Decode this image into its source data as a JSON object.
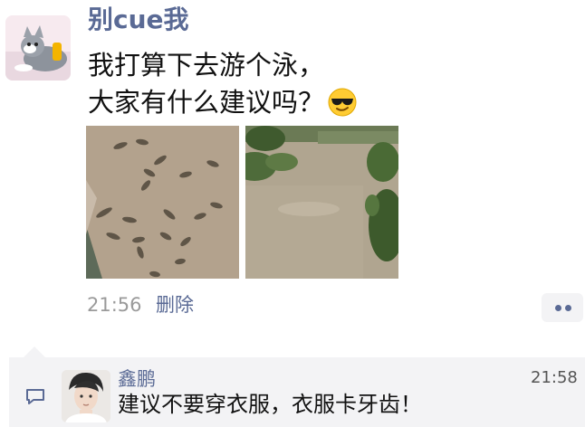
{
  "post": {
    "username": "别cue我",
    "text_line1": "我打算下去游个泳，",
    "text_line2": "大家有什么建议吗？",
    "emoji": "smiling-face-with-sunglasses",
    "images": [
      {
        "name": "crocodiles-in-muddy-water"
      },
      {
        "name": "muddy-river"
      }
    ],
    "time": "21:56",
    "delete_label": "删除",
    "more_icon": "more-dots-icon"
  },
  "comment": {
    "author": "鑫鹏",
    "time": "21:58",
    "text": "建议不要穿衣服，衣服卡牙齿！",
    "icon": "comment-icon"
  },
  "colors": {
    "link": "#5a6a95",
    "comment_bg": "#f3f3f5",
    "timestamp": "#9a9a9a"
  }
}
